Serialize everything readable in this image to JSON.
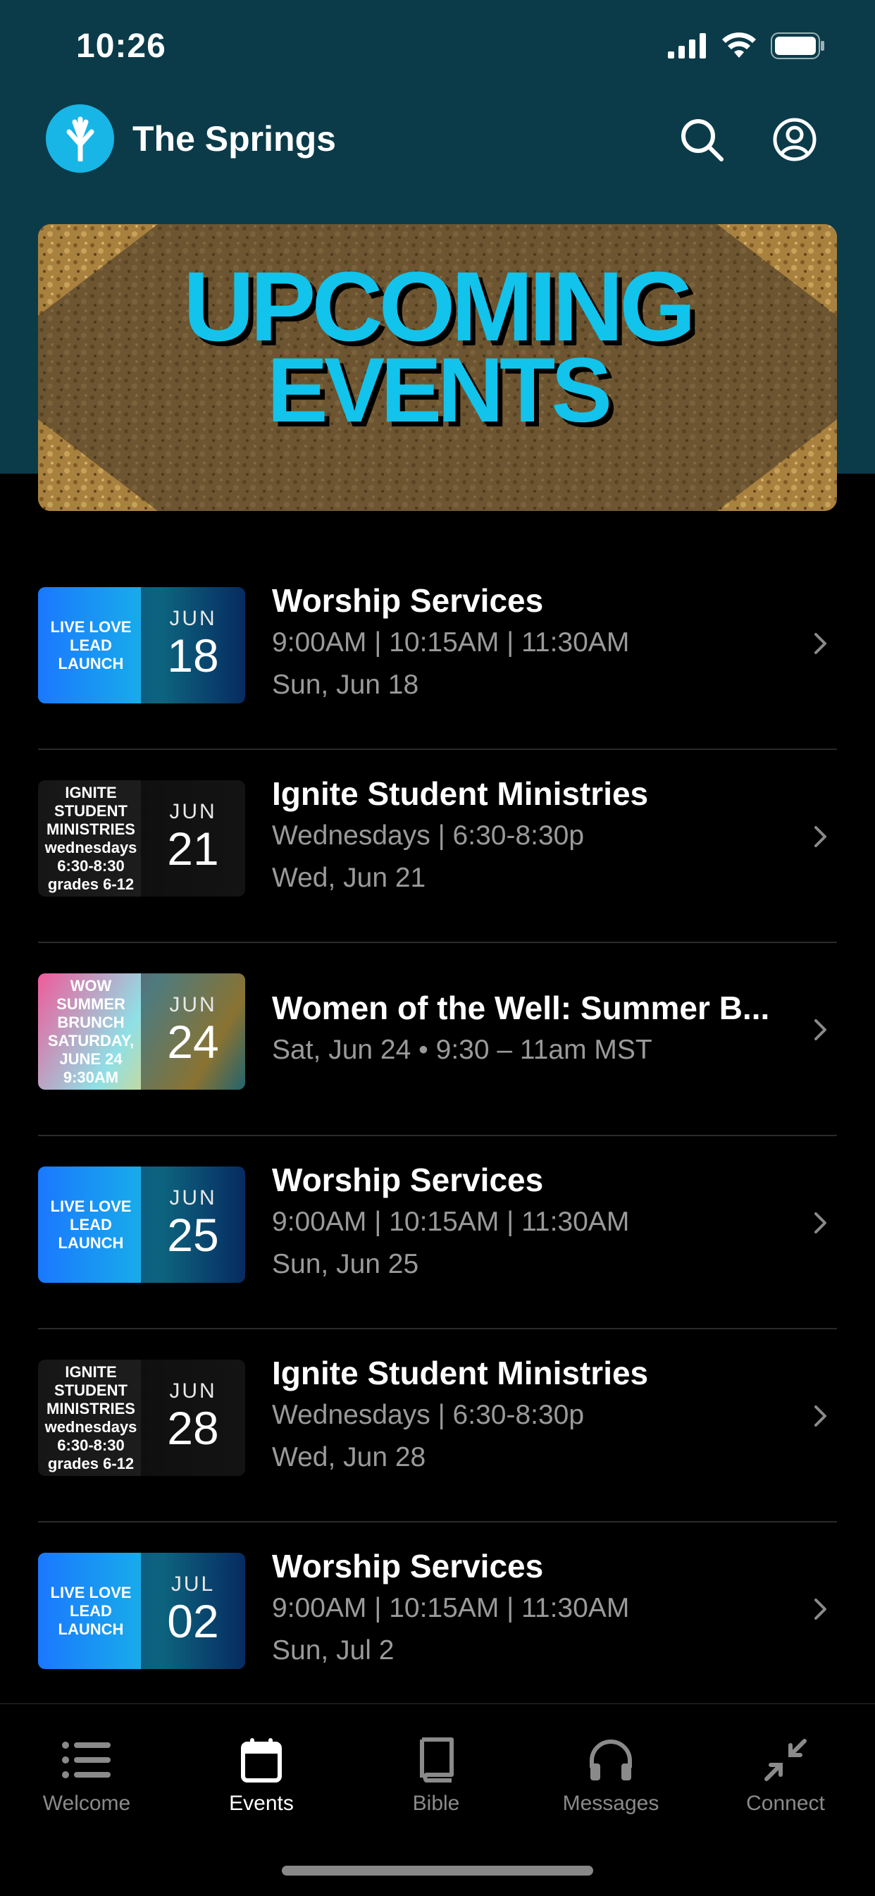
{
  "status": {
    "time": "10:26"
  },
  "app": {
    "title": "The Springs"
  },
  "banner": {
    "line1": "UPCOMING",
    "line2": "EVENTS"
  },
  "events": [
    {
      "title": "Worship Services",
      "line1": "9:00AM | 10:15AM | 11:30AM",
      "line2": "Sun, Jun 18",
      "month": "JUN",
      "day": "18",
      "thumb_text": "LIVE LOVE LEAD LAUNCH",
      "thumb_style": "blue"
    },
    {
      "title": "Ignite Student Ministries",
      "line1": "Wednesdays | 6:30-8:30p",
      "line2": "Wed, Jun 21",
      "month": "JUN",
      "day": "21",
      "thumb_text": "IGNITE STUDENT MINISTRIES wednesdays 6:30-8:30 grades 6-12",
      "thumb_style": "dark"
    },
    {
      "title": "Women of the Well: Summer B...",
      "line1": "Sat, Jun 24 • 9:30 – 11am MST",
      "line2": "",
      "month": "JUN",
      "day": "24",
      "thumb_text": "WOW SUMMER BRUNCH SATURDAY, JUNE 24 9:30AM",
      "thumb_style": "bright"
    },
    {
      "title": "Worship Services",
      "line1": "9:00AM | 10:15AM | 11:30AM",
      "line2": "Sun, Jun 25",
      "month": "JUN",
      "day": "25",
      "thumb_text": "LIVE LOVE LEAD LAUNCH",
      "thumb_style": "blue"
    },
    {
      "title": "Ignite Student Ministries",
      "line1": "Wednesdays | 6:30-8:30p",
      "line2": "Wed, Jun 28",
      "month": "JUN",
      "day": "28",
      "thumb_text": "IGNITE STUDENT MINISTRIES wednesdays 6:30-8:30 grades 6-12",
      "thumb_style": "dark"
    },
    {
      "title": "Worship Services",
      "line1": "9:00AM | 10:15AM | 11:30AM",
      "line2": "Sun, Jul 2",
      "month": "JUL",
      "day": "02",
      "thumb_text": "LIVE LOVE LEAD LAUNCH",
      "thumb_style": "blue"
    }
  ],
  "tabs": [
    {
      "label": "Welcome",
      "icon": "list-icon",
      "active": false
    },
    {
      "label": "Events",
      "icon": "calendar-icon",
      "active": true
    },
    {
      "label": "Bible",
      "icon": "book-icon",
      "active": false
    },
    {
      "label": "Messages",
      "icon": "headphones-icon",
      "active": false
    },
    {
      "label": "Connect",
      "icon": "collapse-arrows-icon",
      "active": false
    }
  ],
  "colors": {
    "header_bg": "#0b3b49",
    "accent": "#18b6e6",
    "background": "#000000"
  }
}
